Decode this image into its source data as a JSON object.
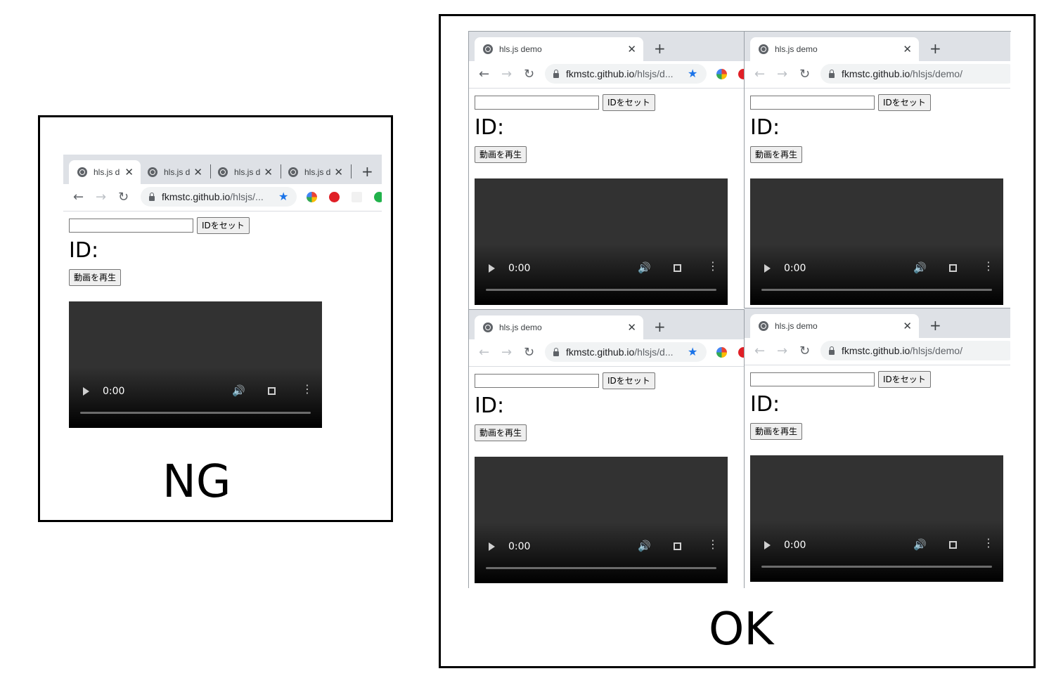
{
  "captions": {
    "ng": "NG",
    "ok": "OK"
  },
  "browser": {
    "tab_title": "hls.js demo",
    "tab_title_short": "hls.js d",
    "close_glyph": "✕",
    "newtab_glyph": "+",
    "back_glyph": "←",
    "forward_glyph": "→",
    "reload_glyph": "↻",
    "star_glyph": "★",
    "url_host": "fkmstc.github.io",
    "url_path_full": "/hlsjs/demo/",
    "url_path_trunc": "/hlsjs/d...",
    "url_path_trunc_ng": "/hlsjs/..."
  },
  "page": {
    "set_button_label": "IDをセット",
    "id_label": "ID:",
    "play_button_label": "動画を再生",
    "video_time": "0:00",
    "volume_glyph": "🔊",
    "more_glyph": "⋮",
    "id_input_value": ""
  },
  "colors": {
    "tabstrip": "#dee1e6",
    "star": "#1a73e8",
    "video_top": "#323232",
    "video_bottom": "#000000"
  },
  "icons": [
    "globe-icon",
    "close-icon",
    "plus-icon",
    "back-arrow-icon",
    "forward-arrow-icon",
    "reload-icon",
    "lock-icon",
    "star-icon",
    "extension-icon",
    "play-icon",
    "volume-icon",
    "fullscreen-icon",
    "more-vert-icon"
  ]
}
